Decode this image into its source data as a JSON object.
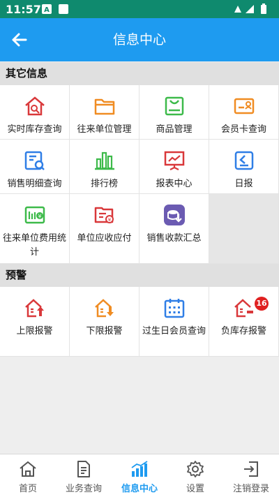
{
  "status_bar": {
    "time": "11:57"
  },
  "header": {
    "title": "信息中心"
  },
  "sections": [
    {
      "title": "其它信息",
      "items": [
        {
          "label": "实时库存查询",
          "icon": "house-search-icon"
        },
        {
          "label": "往来单位管理",
          "icon": "folder-icon"
        },
        {
          "label": "商品管理",
          "icon": "shopping-bag-icon"
        },
        {
          "label": "会员卡查询",
          "icon": "member-card-icon"
        },
        {
          "label": "销售明细查询",
          "icon": "document-search-icon"
        },
        {
          "label": "排行榜",
          "icon": "bar-chart-icon"
        },
        {
          "label": "报表中心",
          "icon": "presentation-chart-icon"
        },
        {
          "label": "日报",
          "icon": "daily-report-icon"
        },
        {
          "label": "往来单位费用统计",
          "icon": "money-stats-icon"
        },
        {
          "label": "单位应收应付",
          "icon": "receivable-payable-icon"
        },
        {
          "label": "销售收款汇总",
          "icon": "payment-summary-icon"
        }
      ]
    },
    {
      "title": "预警",
      "items": [
        {
          "label": "上限报警",
          "icon": "upper-limit-alarm-icon"
        },
        {
          "label": "下限报警",
          "icon": "lower-limit-alarm-icon"
        },
        {
          "label": "过生日会员查询",
          "icon": "birthday-calendar-icon"
        },
        {
          "label": "负库存报警",
          "icon": "negative-stock-alarm-icon",
          "badge": "16"
        }
      ]
    }
  ],
  "bottom_nav": {
    "items": [
      {
        "label": "首页",
        "icon": "home-icon"
      },
      {
        "label": "业务查询",
        "icon": "business-query-icon"
      },
      {
        "label": "信息中心",
        "icon": "info-center-icon",
        "active": true
      },
      {
        "label": "设置",
        "icon": "settings-gear-icon"
      },
      {
        "label": "注销登录",
        "icon": "logout-icon"
      }
    ]
  },
  "colors": {
    "status_bar": "#0f8a6e",
    "app_bar": "#1e9bf0",
    "active_tab": "#1e9bf0",
    "badge": "#e02020"
  }
}
